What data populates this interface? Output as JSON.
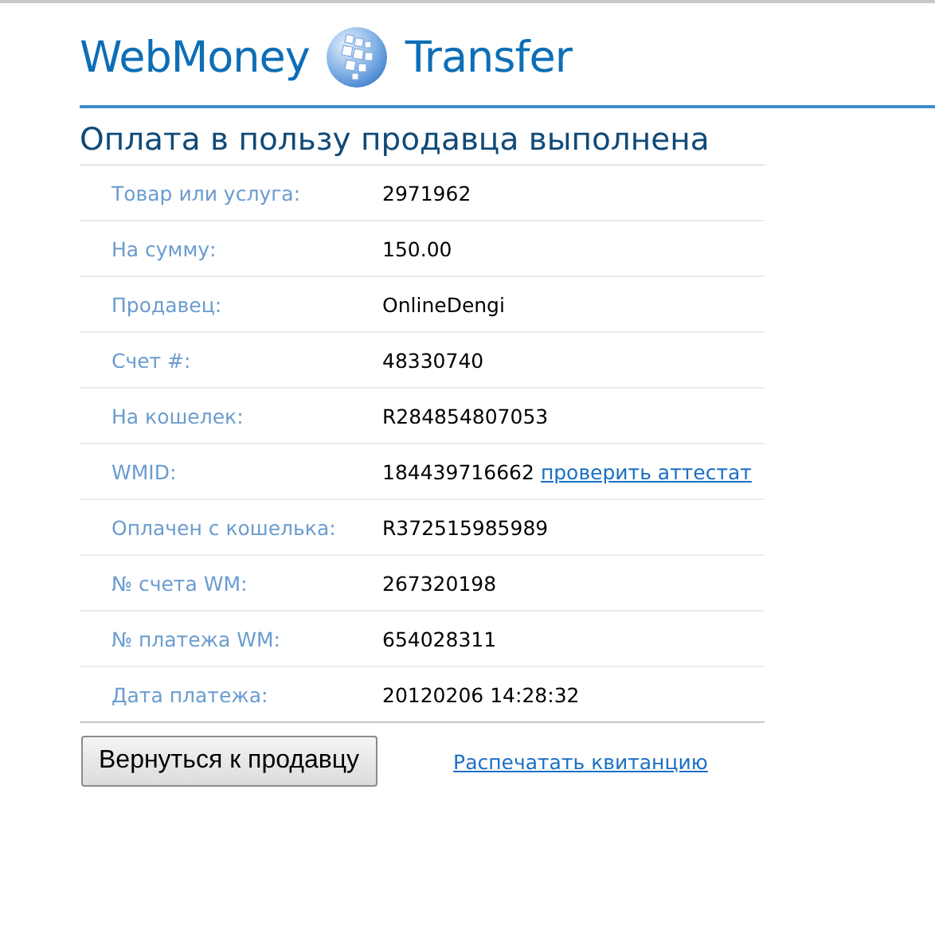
{
  "logo": {
    "brand": "WebMoney",
    "product": "Transfer"
  },
  "heading": "Оплата в пользу продавца выполнена",
  "details": [
    {
      "label": "Товар или услуга:",
      "value": "2971962"
    },
    {
      "label": "На сумму:",
      "value": "150.00"
    },
    {
      "label": "Продавец:",
      "value": "OnlineDengi"
    },
    {
      "label": "Счет #:",
      "value": "48330740"
    },
    {
      "label": "На кошелек:",
      "value": "R284854807053"
    },
    {
      "label": "WMID:",
      "value": "184439716662",
      "link": "проверить аттестат"
    },
    {
      "label": "Оплачен с кошелька:",
      "value": "R372515985989"
    },
    {
      "label": "№ счета WM:",
      "value": "267320198"
    },
    {
      "label": "№ платежа WM:",
      "value": "654028311"
    },
    {
      "label": "Дата платежа:",
      "value": "20120206 14:28:32"
    }
  ],
  "buttons": [
    {
      "label": "Вернуться к продавцу",
      "kind": "button"
    },
    {
      "label": "Распечатать квитанцию",
      "kind": "link"
    }
  ]
}
